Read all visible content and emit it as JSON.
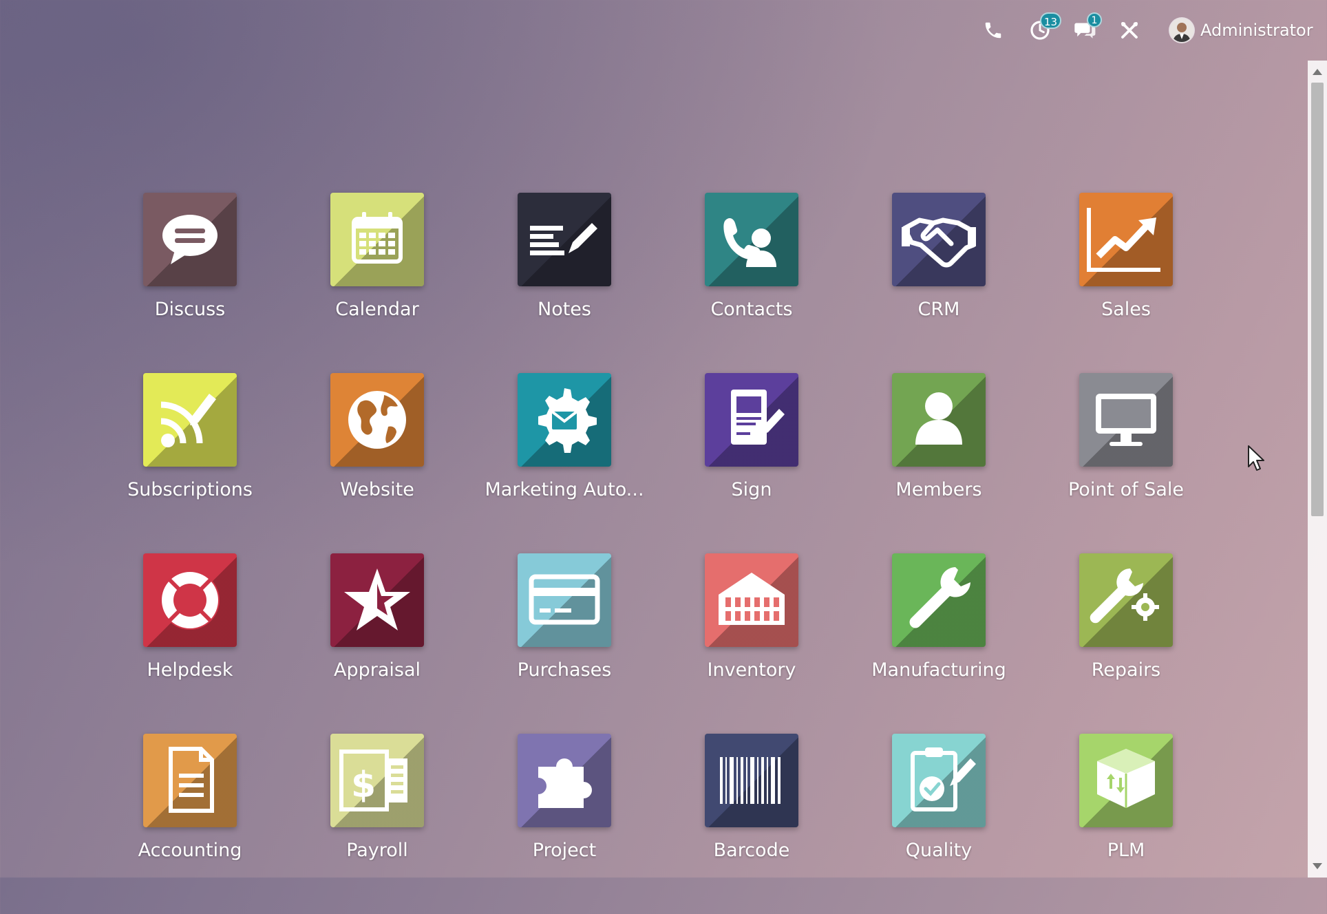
{
  "topbar": {
    "activity_count": "13",
    "message_count": "1",
    "user_name": "Administrator"
  },
  "apps": [
    {
      "label": "Discuss",
      "color": "#7a5a62",
      "icon": "chat-bubble-icon"
    },
    {
      "label": "Calendar",
      "color": "#d6e07a",
      "icon": "calendar-icon"
    },
    {
      "label": "Notes",
      "color": "#2c2d3b",
      "icon": "notes-icon"
    },
    {
      "label": "Contacts",
      "color": "#2f8585",
      "icon": "contacts-icon"
    },
    {
      "label": "CRM",
      "color": "#4f4e80",
      "icon": "handshake-icon"
    },
    {
      "label": "Sales",
      "color": "#e17f34",
      "icon": "trend-chart-icon"
    },
    {
      "label": "Subscriptions",
      "color": "#e3ea57",
      "icon": "subscription-feed-icon"
    },
    {
      "label": "Website",
      "color": "#de8436",
      "icon": "globe-icon"
    },
    {
      "label": "Marketing Auto...",
      "color": "#1e96a6",
      "icon": "gear-envelope-icon"
    },
    {
      "label": "Sign",
      "color": "#5c3f9c",
      "icon": "document-sign-icon"
    },
    {
      "label": "Members",
      "color": "#73a552",
      "icon": "member-icon"
    },
    {
      "label": "Point of Sale",
      "color": "#8a8b92",
      "icon": "monitor-icon"
    },
    {
      "label": "Helpdesk",
      "color": "#cf3547",
      "icon": "lifebuoy-icon"
    },
    {
      "label": "Appraisal",
      "color": "#8c2140",
      "icon": "star-icon"
    },
    {
      "label": "Purchases",
      "color": "#86cad8",
      "icon": "credit-card-icon"
    },
    {
      "label": "Inventory",
      "color": "#e56e6d",
      "icon": "warehouse-icon"
    },
    {
      "label": "Manufacturing",
      "color": "#6ab659",
      "icon": "wrench-icon"
    },
    {
      "label": "Repairs",
      "color": "#9cb754",
      "icon": "wrench-gear-icon"
    },
    {
      "label": "Accounting",
      "color": "#e19a4a",
      "icon": "invoice-icon"
    },
    {
      "label": "Payroll",
      "color": "#dadd97",
      "icon": "payroll-icon"
    },
    {
      "label": "Project",
      "color": "#7f74b0",
      "icon": "puzzle-icon"
    },
    {
      "label": "Barcode",
      "color": "#414971",
      "icon": "barcode-icon"
    },
    {
      "label": "Quality",
      "color": "#87d4d1",
      "icon": "quality-check-icon"
    },
    {
      "label": "PLM",
      "color": "#a6d56b",
      "icon": "box-icon"
    }
  ]
}
